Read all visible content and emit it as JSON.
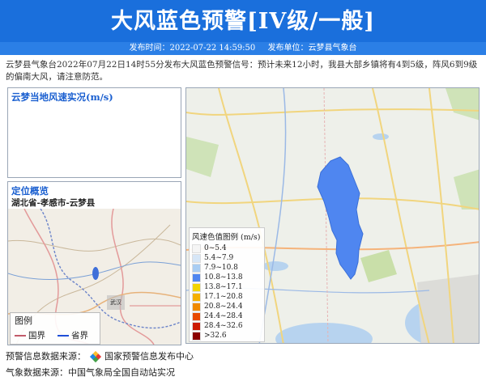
{
  "header": {
    "title": "大风蓝色预警[IV级/一般]",
    "publish_time": "发布时间：2022-07-22 14:59:50",
    "publish_unit": "发布单位：云梦县气象台"
  },
  "description": "云梦县气象台2022年07月22日14时55分发布大风蓝色预警信号：预计未来12小时，我县大部乡镇将有4到5级，阵风6到9级的偏南大风，请注意防范。",
  "wind_panel": {
    "title": "云梦当地风速实况(m/s)"
  },
  "location_panel": {
    "title": "定位概览",
    "region": "湖北省-孝感市-云梦县",
    "map_label": "武汉",
    "legend_title": "图例",
    "legend_items": [
      {
        "label": "国界",
        "color": "#c25b6a"
      },
      {
        "label": "省界",
        "color": "#1f4fd8"
      }
    ]
  },
  "map_legend": {
    "title": "风速色值图例 (m/s)",
    "items": [
      {
        "label": "0~5.4",
        "color": "#f5f5f5"
      },
      {
        "label": "5.4~7.9",
        "color": "#d6e6f7"
      },
      {
        "label": "7.9~10.8",
        "color": "#a9cdf3"
      },
      {
        "label": "10.8~13.8",
        "color": "#4f86f0"
      },
      {
        "label": "13.8~17.1",
        "color": "#f2d400"
      },
      {
        "label": "17.1~20.8",
        "color": "#f5b000"
      },
      {
        "label": "20.8~24.4",
        "color": "#f08a00"
      },
      {
        "label": "24.4~28.4",
        "color": "#e84a00"
      },
      {
        "label": "28.4~32.6",
        "color": "#cc1a00"
      },
      {
        "label": ">32.6",
        "color": "#8a0000"
      }
    ]
  },
  "footer": {
    "source1_prefix": "预警信息数据来源：",
    "source1_name": "国家预警信息发布中心",
    "source2": "气象数据来源：中国气象局全国自动站实况"
  }
}
